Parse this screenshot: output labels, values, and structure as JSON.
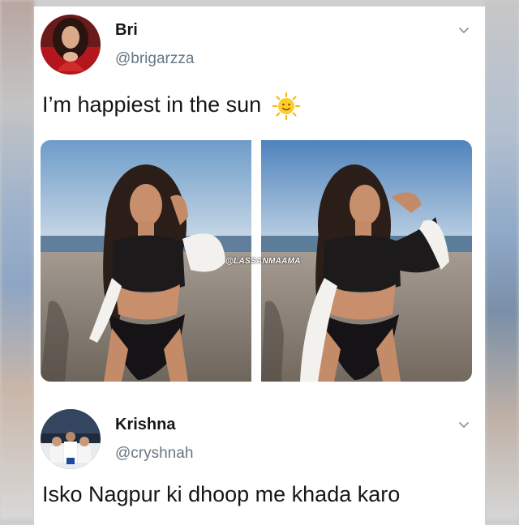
{
  "tweet1": {
    "name": "Bri",
    "handle": "@brigarzza",
    "text": "I’m happiest in the sun",
    "emoji_icon": "sun-face-icon"
  },
  "watermark": "@LASSANMAAMA",
  "tweet2": {
    "name": "Krishna",
    "handle": "@cryshnah",
    "text": "Isko Nagpur ki dhoop me khada karo"
  },
  "colors": {
    "name": "#14171a",
    "handle": "#657786",
    "card": "#ffffff"
  }
}
